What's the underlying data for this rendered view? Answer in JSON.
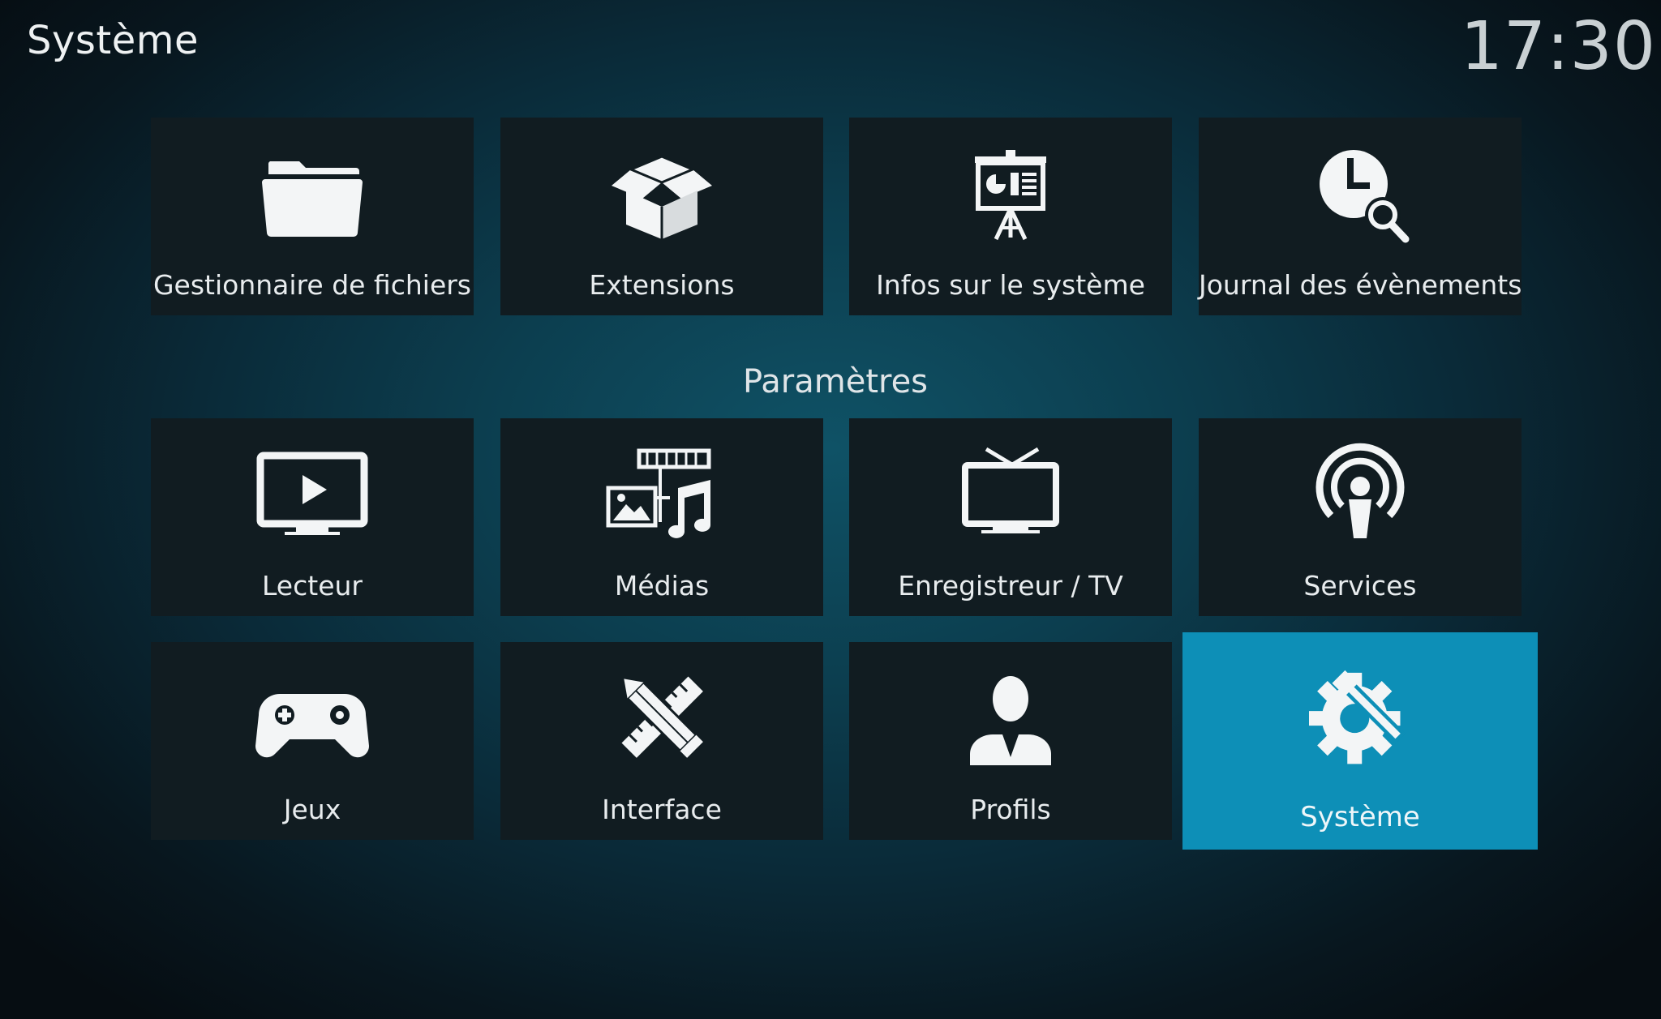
{
  "header": {
    "title": "Système",
    "clock": "17:30"
  },
  "top_tiles": [
    {
      "label": "Gestionnaire de fichiers",
      "icon": "folder-icon"
    },
    {
      "label": "Extensions",
      "icon": "open-box-icon"
    },
    {
      "label": "Infos sur le système",
      "icon": "presentation-board-icon"
    },
    {
      "label": "Journal des évènements",
      "icon": "clock-search-icon"
    }
  ],
  "settings": {
    "heading": "Paramètres",
    "tiles": [
      {
        "label": "Lecteur",
        "icon": "tv-play-icon"
      },
      {
        "label": "Médias",
        "icon": "media-icon"
      },
      {
        "label": "Enregistreur / TV",
        "icon": "tv-antenna-icon"
      },
      {
        "label": "Services",
        "icon": "broadcast-icon"
      },
      {
        "label": "Jeux",
        "icon": "gamepad-icon"
      },
      {
        "label": "Interface",
        "icon": "ruler-pencil-icon"
      },
      {
        "label": "Profils",
        "icon": "user-icon"
      },
      {
        "label": "Système",
        "icon": "gear-wrench-icon",
        "focused": true
      }
    ]
  },
  "colors": {
    "tile_background": "#111c21",
    "focused_tile": "#0d8fb7",
    "text": "#e8ecee"
  }
}
